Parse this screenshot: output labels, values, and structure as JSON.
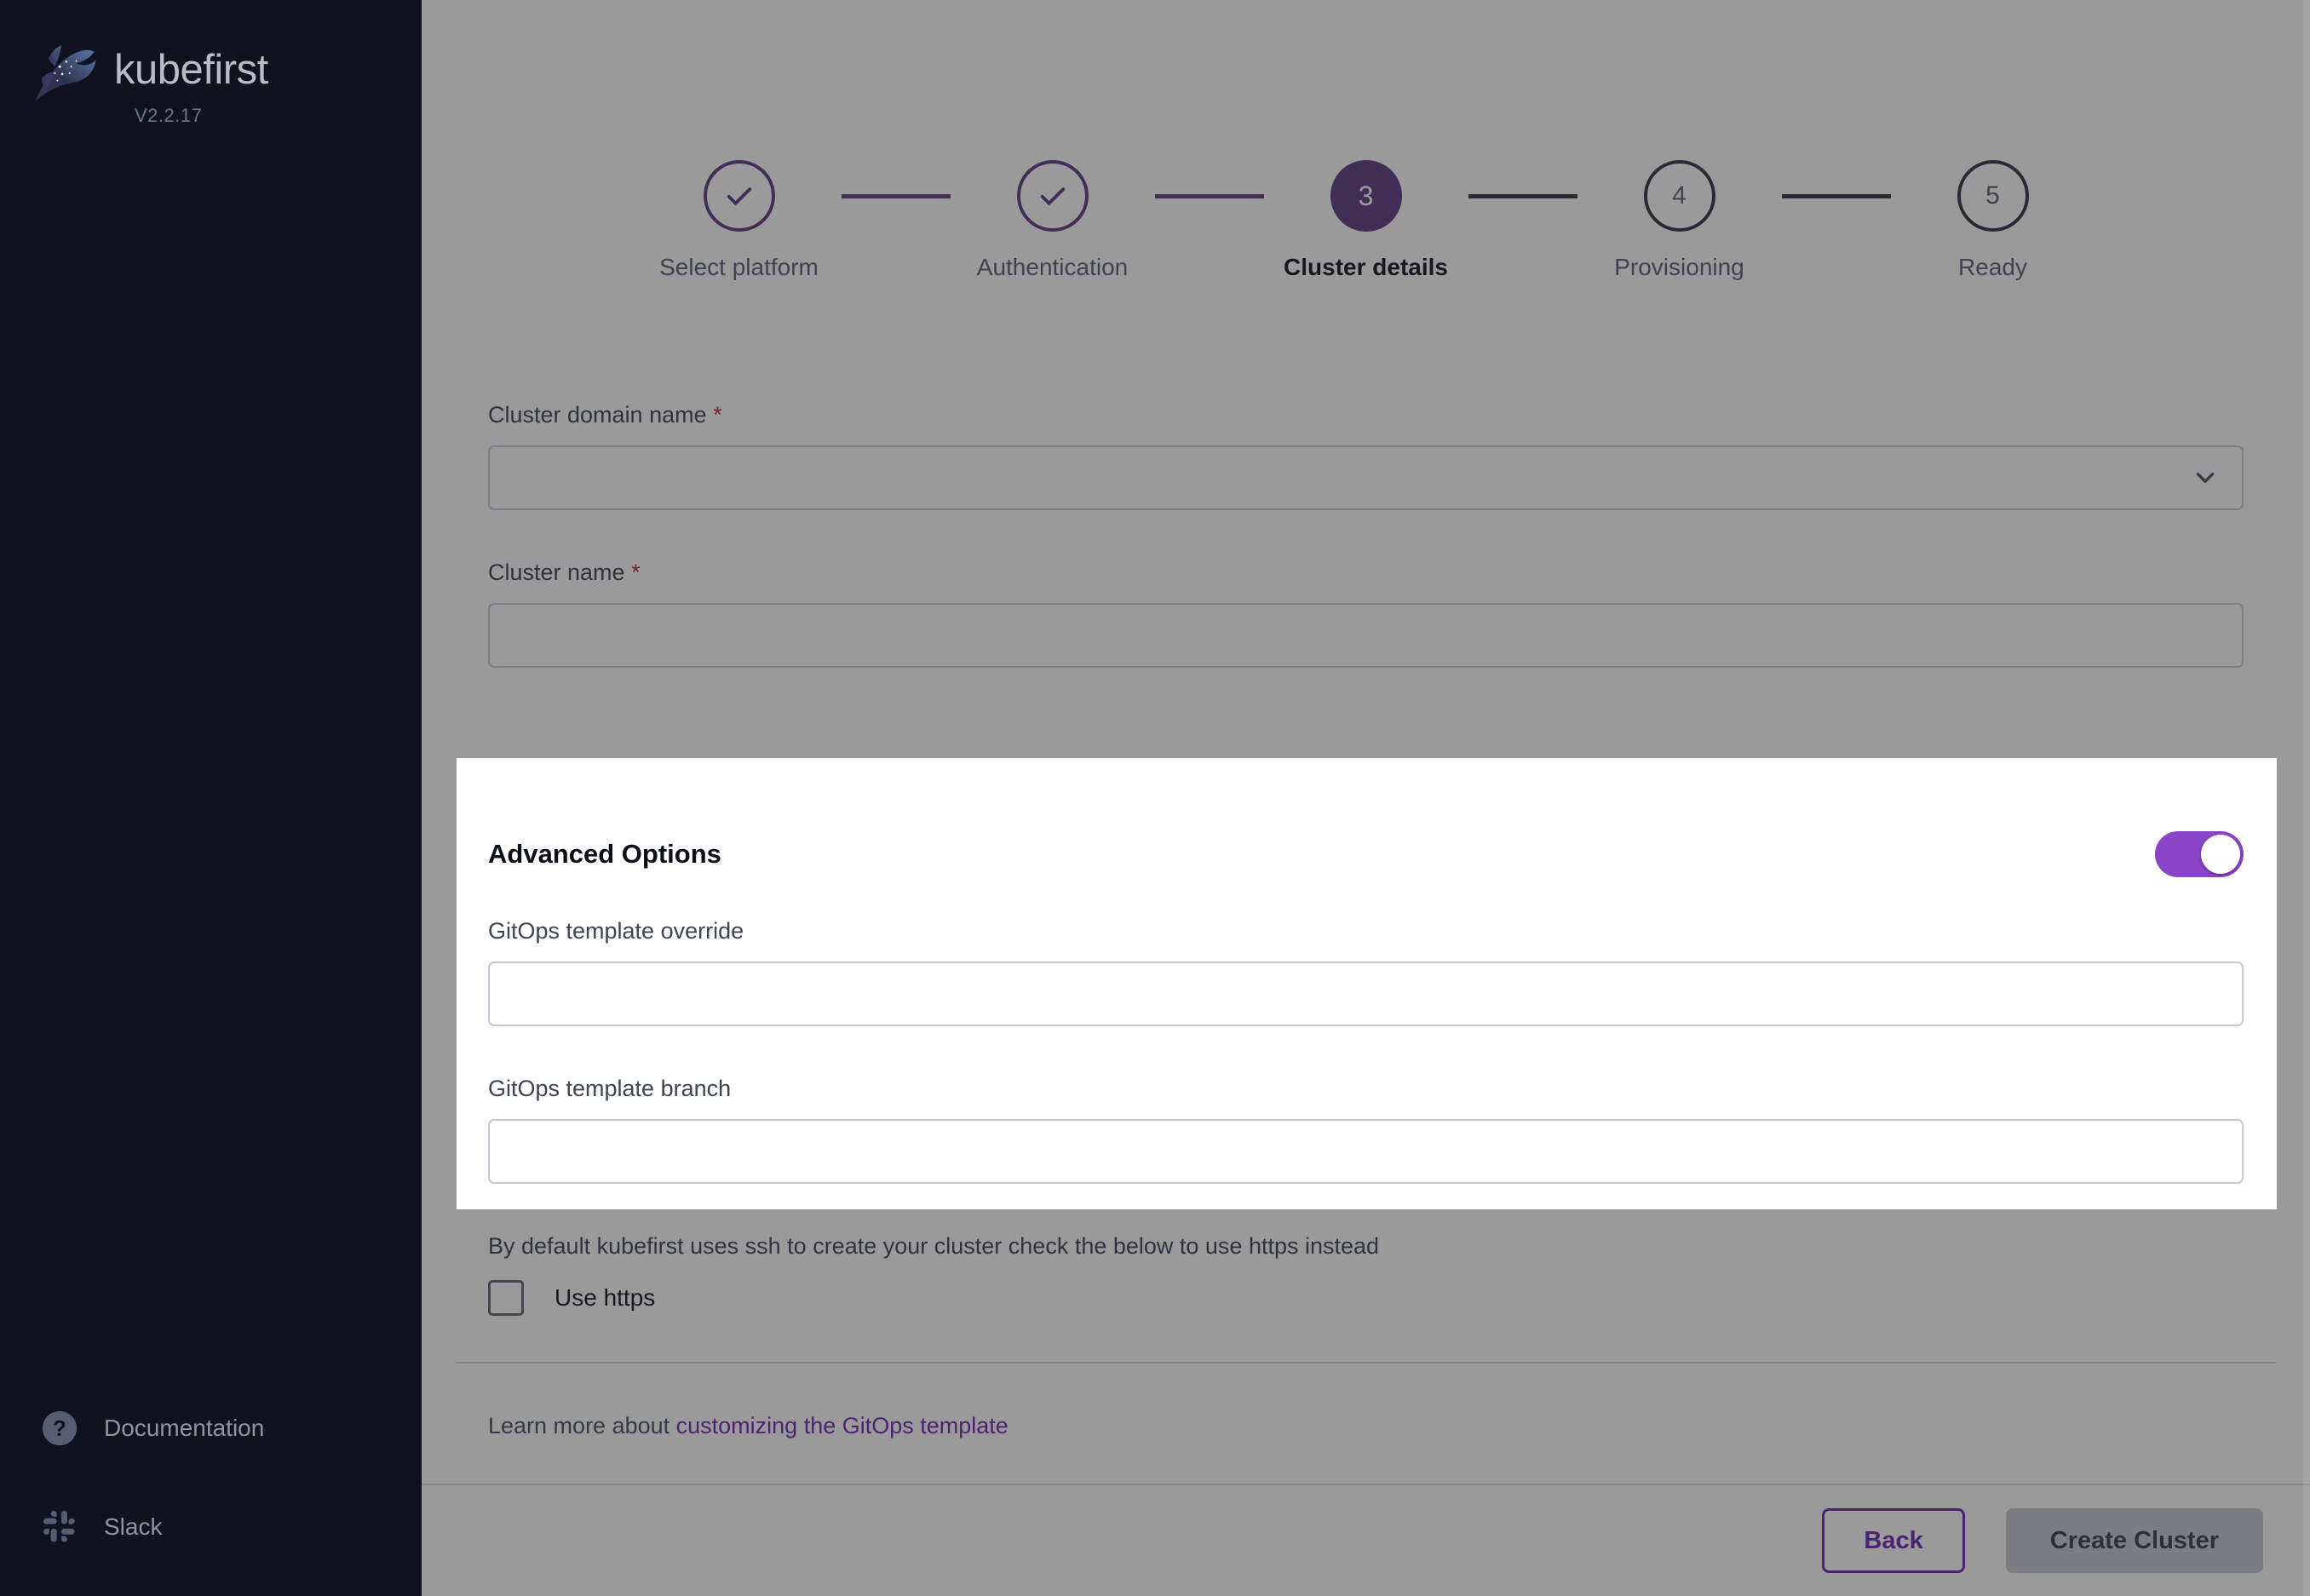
{
  "sidebar": {
    "brand": {
      "name": "kubefirst",
      "version": "V2.2.17",
      "logo_icon": "kubefirst-ray-logo-icon"
    },
    "links": [
      {
        "label": "Documentation",
        "icon": "help-circle-icon"
      },
      {
        "label": "Slack",
        "icon": "slack-icon"
      }
    ]
  },
  "stepper": {
    "steps": [
      {
        "index": "1",
        "label": "Select platform",
        "state": "done",
        "glyph": "check-icon"
      },
      {
        "index": "2",
        "label": "Authentication",
        "state": "done",
        "glyph": "check-icon"
      },
      {
        "index": "3",
        "label": "Cluster details",
        "state": "active",
        "glyph": "3"
      },
      {
        "index": "4",
        "label": "Provisioning",
        "state": "upcoming",
        "glyph": "4"
      },
      {
        "index": "5",
        "label": "Ready",
        "state": "upcoming",
        "glyph": "5"
      }
    ]
  },
  "cluster_form": {
    "domain": {
      "label": "Cluster domain name",
      "required_marker": "*",
      "value": "",
      "placeholder": "",
      "icon": "chevron-down-icon"
    },
    "name": {
      "label": "Cluster name",
      "required_marker": "*",
      "value": "",
      "placeholder": ""
    }
  },
  "advanced_options": {
    "title": "Advanced Options",
    "toggle_state": "on",
    "fields": [
      {
        "label": "GitOps template override",
        "value": "",
        "placeholder": ""
      },
      {
        "label": "GitOps template branch",
        "value": "",
        "placeholder": ""
      }
    ]
  },
  "https_section": {
    "helper_text": "By default kubefirst uses ssh to create your cluster check the below to use https instead",
    "checkbox_label": "Use https",
    "checked": false
  },
  "learn_more": {
    "prefix": "Learn more about ",
    "link_text": "customizing the GitOps template"
  },
  "footer": {
    "back_label": "Back",
    "create_label": "Create Cluster"
  },
  "colors": {
    "brand_purple": "#6d28b5",
    "toggle_purple": "#8b44c7",
    "step_active": "#5e3a82",
    "sidebar_bg": "#10131f",
    "required_red": "#b32b2b",
    "dim_overlay": "rgba(30,30,34,0.45)"
  }
}
